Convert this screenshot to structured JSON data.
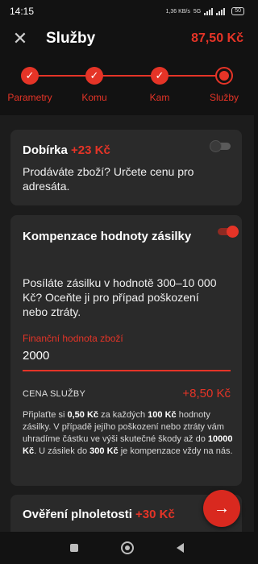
{
  "status_bar": {
    "time": "14:15",
    "net_speed": "1,36 KB/s",
    "network": "5G",
    "battery": "50"
  },
  "app_bar": {
    "title": "Služby",
    "total_price": "87,50 Kč",
    "close_icon": "close-icon"
  },
  "steps": [
    {
      "label": "Parametry",
      "state": "done"
    },
    {
      "label": "Komu",
      "state": "done"
    },
    {
      "label": "Kam",
      "state": "done"
    },
    {
      "label": "Služby",
      "state": "current"
    }
  ],
  "services": {
    "cod": {
      "title": "Dobírka",
      "extra": "+23 Kč",
      "description": "Prodáváte zboží? Určete cenu pro adresáta.",
      "enabled": false
    },
    "insurance": {
      "title": "Kompenzace hodnoty zásilky",
      "description": "Posíláte zásilku v hodnotě 300–10 000 Kč? Oceňte ji pro případ poškození nebo ztráty.",
      "enabled": true,
      "field_label": "Finanční hodnota zboží",
      "field_value": "2000",
      "price_label": "CENA SLUŽBY",
      "price_value": "+8,50 Kč",
      "note_1": "Připlaťte si ",
      "note_b1": "0,50 Kč",
      "note_2": " za každých ",
      "note_b2": "100 Kč",
      "note_3": " hodnoty zásilky. V případě jejího poškození nebo ztráty vám uhradíme částku ve výši skutečné škody až do ",
      "note_b3": "10000 Kč",
      "note_4": ". U zásilek do ",
      "note_b4": "300 Kč",
      "note_5": " je kompenzace vždy na nás."
    },
    "age_check": {
      "title": "Ověření plnoletosti",
      "extra": "+30 Kč"
    }
  },
  "fab": {
    "icon": "arrow-right-icon"
  },
  "colors": {
    "accent": "#e53427",
    "background": "#121212",
    "card": "#2a2a2a"
  }
}
